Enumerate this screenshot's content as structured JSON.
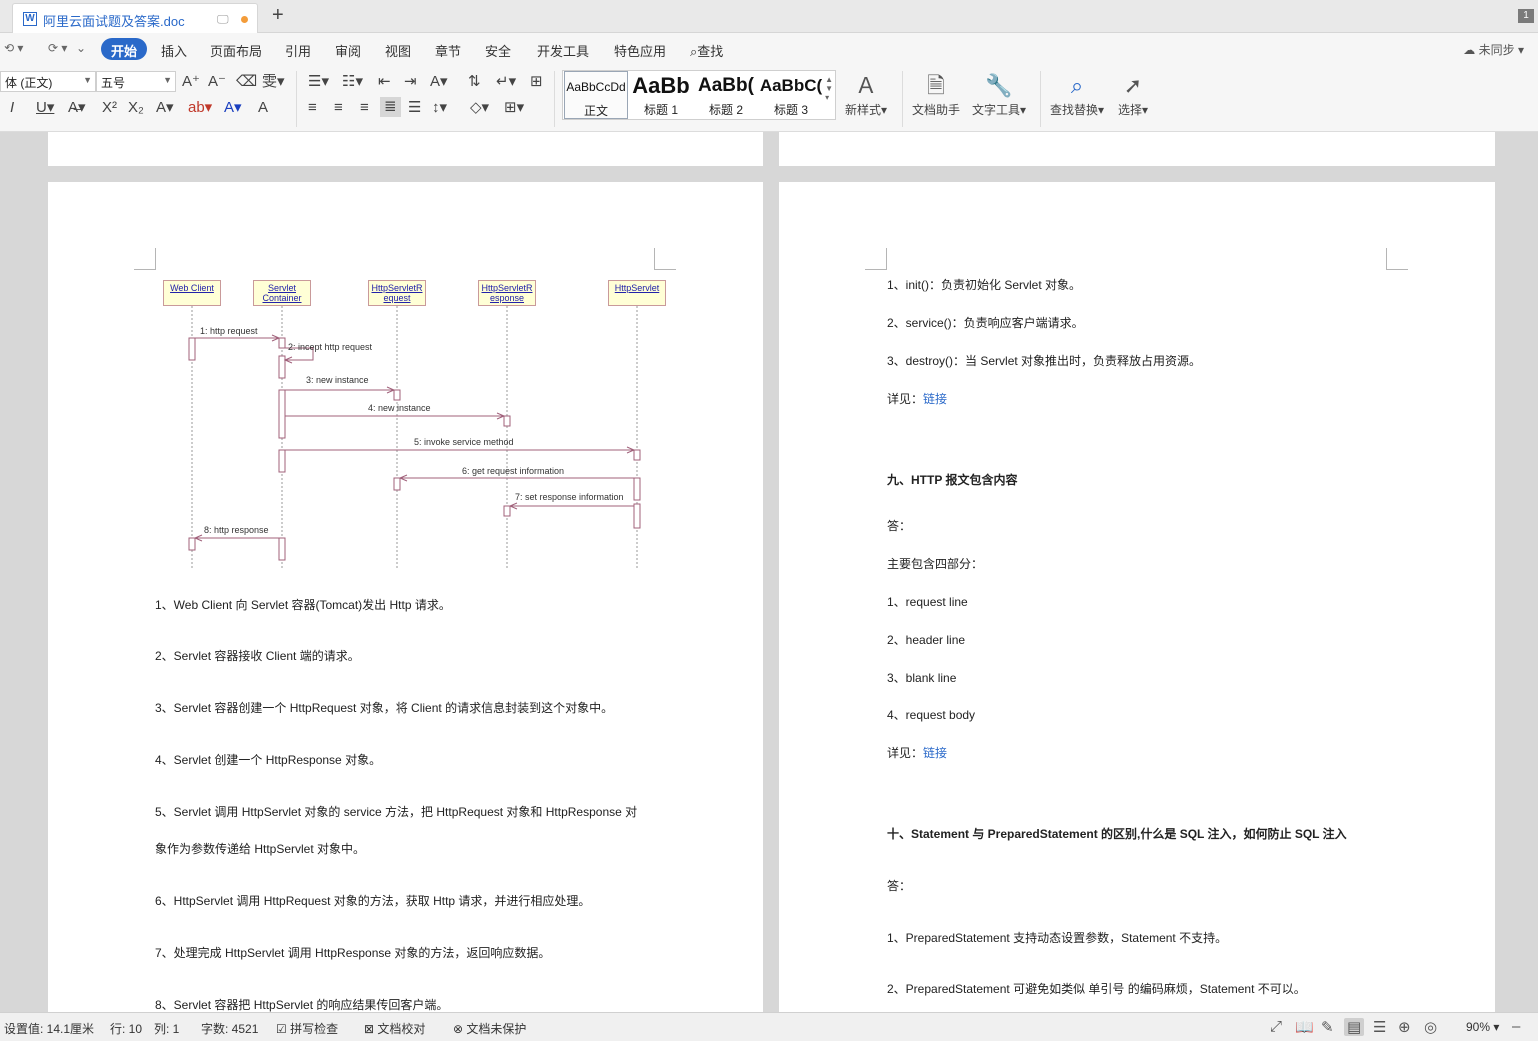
{
  "tab": {
    "title": "阿里云面试题及答案.doc",
    "page_count": "1"
  },
  "menu": {
    "items": [
      "开始",
      "插入",
      "页面布局",
      "引用",
      "审阅",
      "视图",
      "章节",
      "安全",
      "开发工具",
      "特色应用"
    ],
    "search": "查找",
    "sync": "未同步"
  },
  "ribbon": {
    "font_name": "体 (正文)",
    "font_size": "五号",
    "styles": [
      {
        "sample": "AaBbCcDd",
        "label": "正文"
      },
      {
        "sample": "AaBb",
        "label": "标题 1"
      },
      {
        "sample": "AaBb(",
        "label": "标题 2"
      },
      {
        "sample": "AaBbC(",
        "label": "标题 3"
      }
    ],
    "new_style": "新样式",
    "doc_assistant": "文档助手",
    "text_tools": "文字工具",
    "find_replace": "查找替换",
    "select": "选择"
  },
  "diagram": {
    "lifelines": [
      "Web Client",
      "Servlet Container",
      "HttpServletR equest",
      "HttpServletR esponse",
      "HttpServlet"
    ],
    "messages": [
      "1: http request",
      "2: incept http request",
      "3: new instance",
      "4: new instance",
      "5: invoke service method",
      "6: get request information",
      "7: set response information",
      "8: http response"
    ]
  },
  "left_page": {
    "paragraphs": [
      "1、Web Client 向 Servlet 容器(Tomcat)发出 Http 请求。",
      "2、Servlet 容器接收 Client 端的请求。",
      "3、Servlet 容器创建一个 HttpRequest 对象，将 Client 的请求信息封装到这个对象中。",
      "4、Servlet 创建一个 HttpResponse 对象。",
      "5、Servlet 调用 HttpServlet 对象的 service 方法，把 HttpRequest 对象和 HttpResponse 对",
      "象作为参数传递给 HttpServlet 对象中。",
      "6、HttpServlet 调用 HttpRequest 对象的方法，获取 Http 请求，并进行相应处理。",
      "7、处理完成 HttpServlet 调用 HttpResponse 对象的方法，返回响应数据。",
      "8、Servlet 容器把 HttpServlet 的响应结果传回客户端。"
    ]
  },
  "right_page": {
    "lines": [
      "1、init()：负责初始化 Servlet 对象。",
      "2、service()：负责响应客户端请求。",
      "3、destroy()：当 Servlet 对象推出时，负责释放占用资源。"
    ],
    "detail_label": "详见：",
    "link_text": "链接",
    "heading_9": "九、HTTP 报文包含内容",
    "answer": "答：",
    "main_four": "主要包含四部分：",
    "http_parts": [
      "1、request line",
      "2、header line",
      "3、blank line",
      "4、request body"
    ],
    "heading_10": "十、Statement 与 PreparedStatement 的区别,什么是 SQL 注入，如何防止 SQL 注入",
    "answers_10": [
      "1、PreparedStatement 支持动态设置参数，Statement 不支持。",
      "2、PreparedStatement 可避免如类似 单引号 的编码麻烦，Statement 不可以。"
    ]
  },
  "status": {
    "setting": "设置值: 14.1厘米",
    "row": "行: 10",
    "col": "列: 1",
    "word_count": "字数: 4521",
    "spell_check": "拼写检查",
    "proofread": "文档校对",
    "unprotected": "文档未保护",
    "zoom": "90%"
  }
}
